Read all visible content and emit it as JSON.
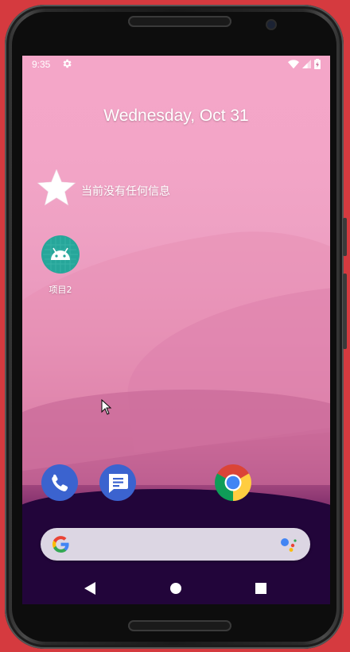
{
  "status_bar": {
    "time": "9:35",
    "left_icons": [
      "gear-icon"
    ],
    "right_icons": [
      "wifi-icon",
      "signal-icon",
      "battery-icon"
    ]
  },
  "date_widget": {
    "text": "Wednesday, Oct 31"
  },
  "notification_widget": {
    "icon": "star-icon",
    "text": "当前没有任何信息"
  },
  "apps": [
    {
      "label": "项目2",
      "icon": "android-icon",
      "color": "#26a69a"
    }
  ],
  "dock": [
    {
      "name": "phone",
      "icon": "phone-icon",
      "color": "#3b63cf"
    },
    {
      "name": "messages",
      "icon": "messages-icon",
      "color": "#3b63cf"
    },
    {
      "name": "chrome",
      "icon": "chrome-icon",
      "color": "#ffffff"
    }
  ],
  "search_bar": {
    "logo": "google-g-icon",
    "assistant_icon": "assistant-dots-icon"
  },
  "navigation": [
    "back-icon",
    "home-icon",
    "recents-icon"
  ],
  "colors": {
    "frame": "#d53a3f",
    "accent_teal": "#26a69a",
    "dock_blue": "#3b63cf"
  }
}
